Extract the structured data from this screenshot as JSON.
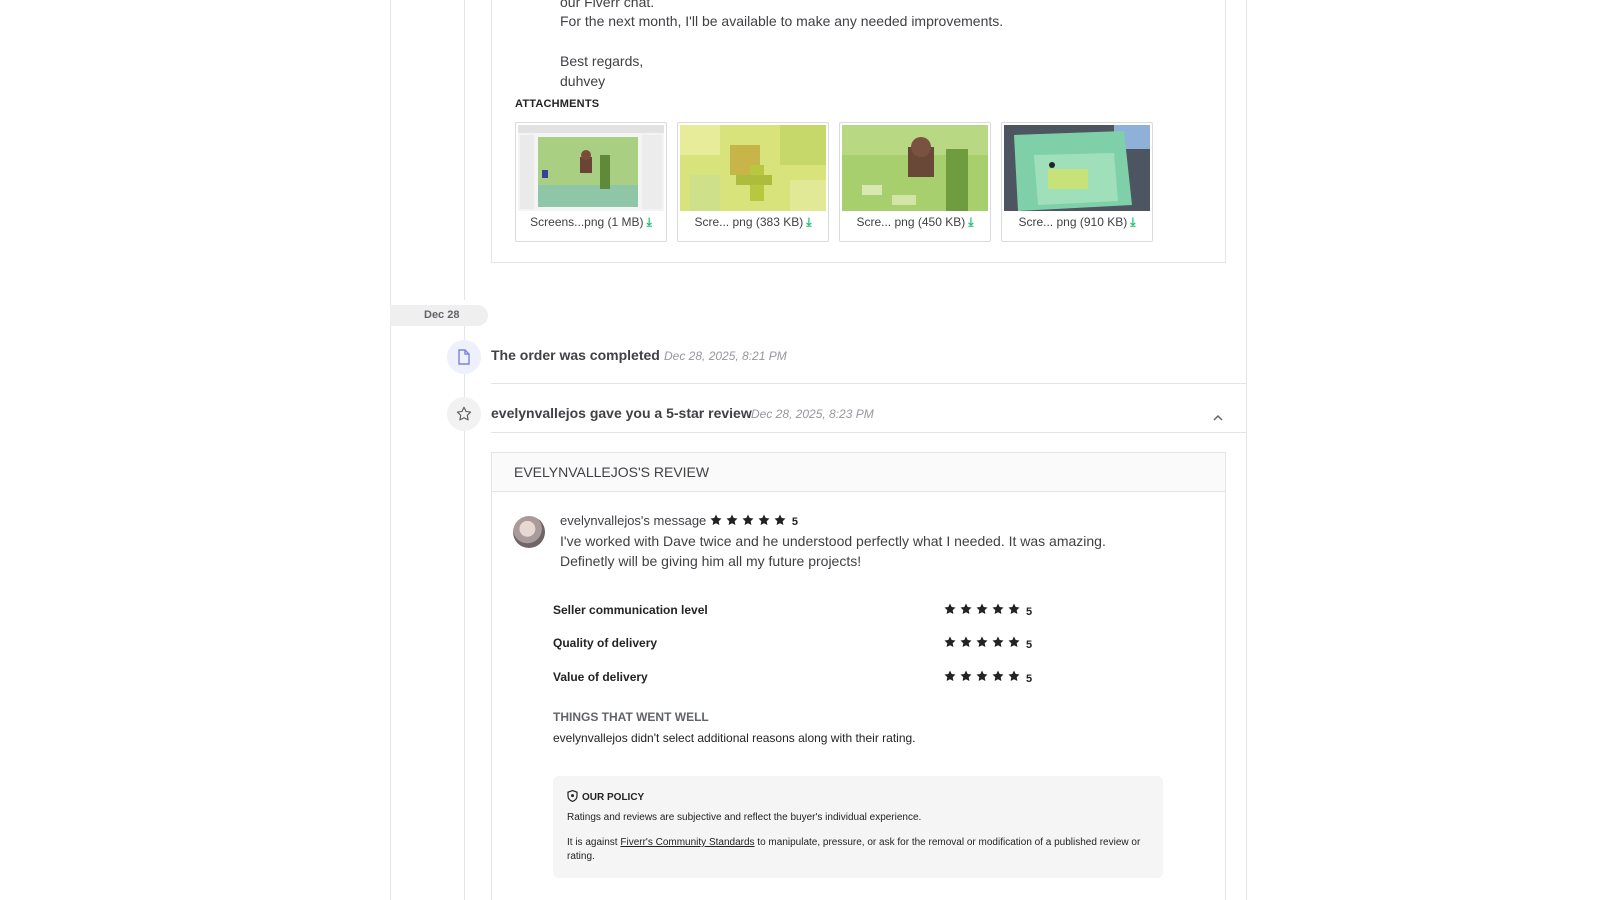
{
  "delivery": {
    "lines": [
      "our Fiverr chat.",
      "For the next month, I'll be available to make any needed improvements.",
      "Best regards,",
      "duhvey"
    ],
    "attachments_title": "ATTACHMENTS",
    "attachments": [
      {
        "name": "Screens...png",
        "size": "(1 MB)"
      },
      {
        "name": "Scre... png",
        "size": "(383 KB)"
      },
      {
        "name": "Scre... png",
        "size": "(450 KB)"
      },
      {
        "name": "Scre... png",
        "size": "(910 KB)"
      }
    ],
    "download_icon": "download-icon"
  },
  "timeline": {
    "date_label": "Dec 28",
    "completed_text": "The order was completed",
    "completed_time": "Dec 28, 2025, 8:21 PM",
    "review_event_text": "evelynvallejos gave you a 5-star review",
    "review_event_time": "Dec 28, 2025, 8:23 PM"
  },
  "review": {
    "header": "EVELYNVALLEJOS'S REVIEW",
    "sender": "evelynvallejos's message",
    "rating": "5",
    "text_line1": "I've worked with Dave twice and he understood perfectly what I needed. It was amazing.",
    "text_line2": "Definetly will be giving him all my future projects!",
    "breakdown": [
      {
        "label": "Seller communication level",
        "score": "5"
      },
      {
        "label": "Quality of delivery",
        "score": "5"
      },
      {
        "label": "Value of delivery",
        "score": "5"
      }
    ],
    "went_well_title": "THINGS THAT WENT WELL",
    "went_well_text": "evelynvallejos didn't select additional reasons along with their rating.",
    "policy": {
      "title": "OUR POLICY",
      "line1": "Ratings and reviews are subjective and reflect the buyer's individual experience.",
      "line2_prefix": "It is against ",
      "line2_link": "Fiverr's Community Standards",
      "line2_suffix": " to manipulate, pressure, or ask for the removal or modification of a published review or rating."
    }
  },
  "colors": {
    "accent_green": "#1dbf73",
    "text": "#404145",
    "muted": "#95979d"
  }
}
